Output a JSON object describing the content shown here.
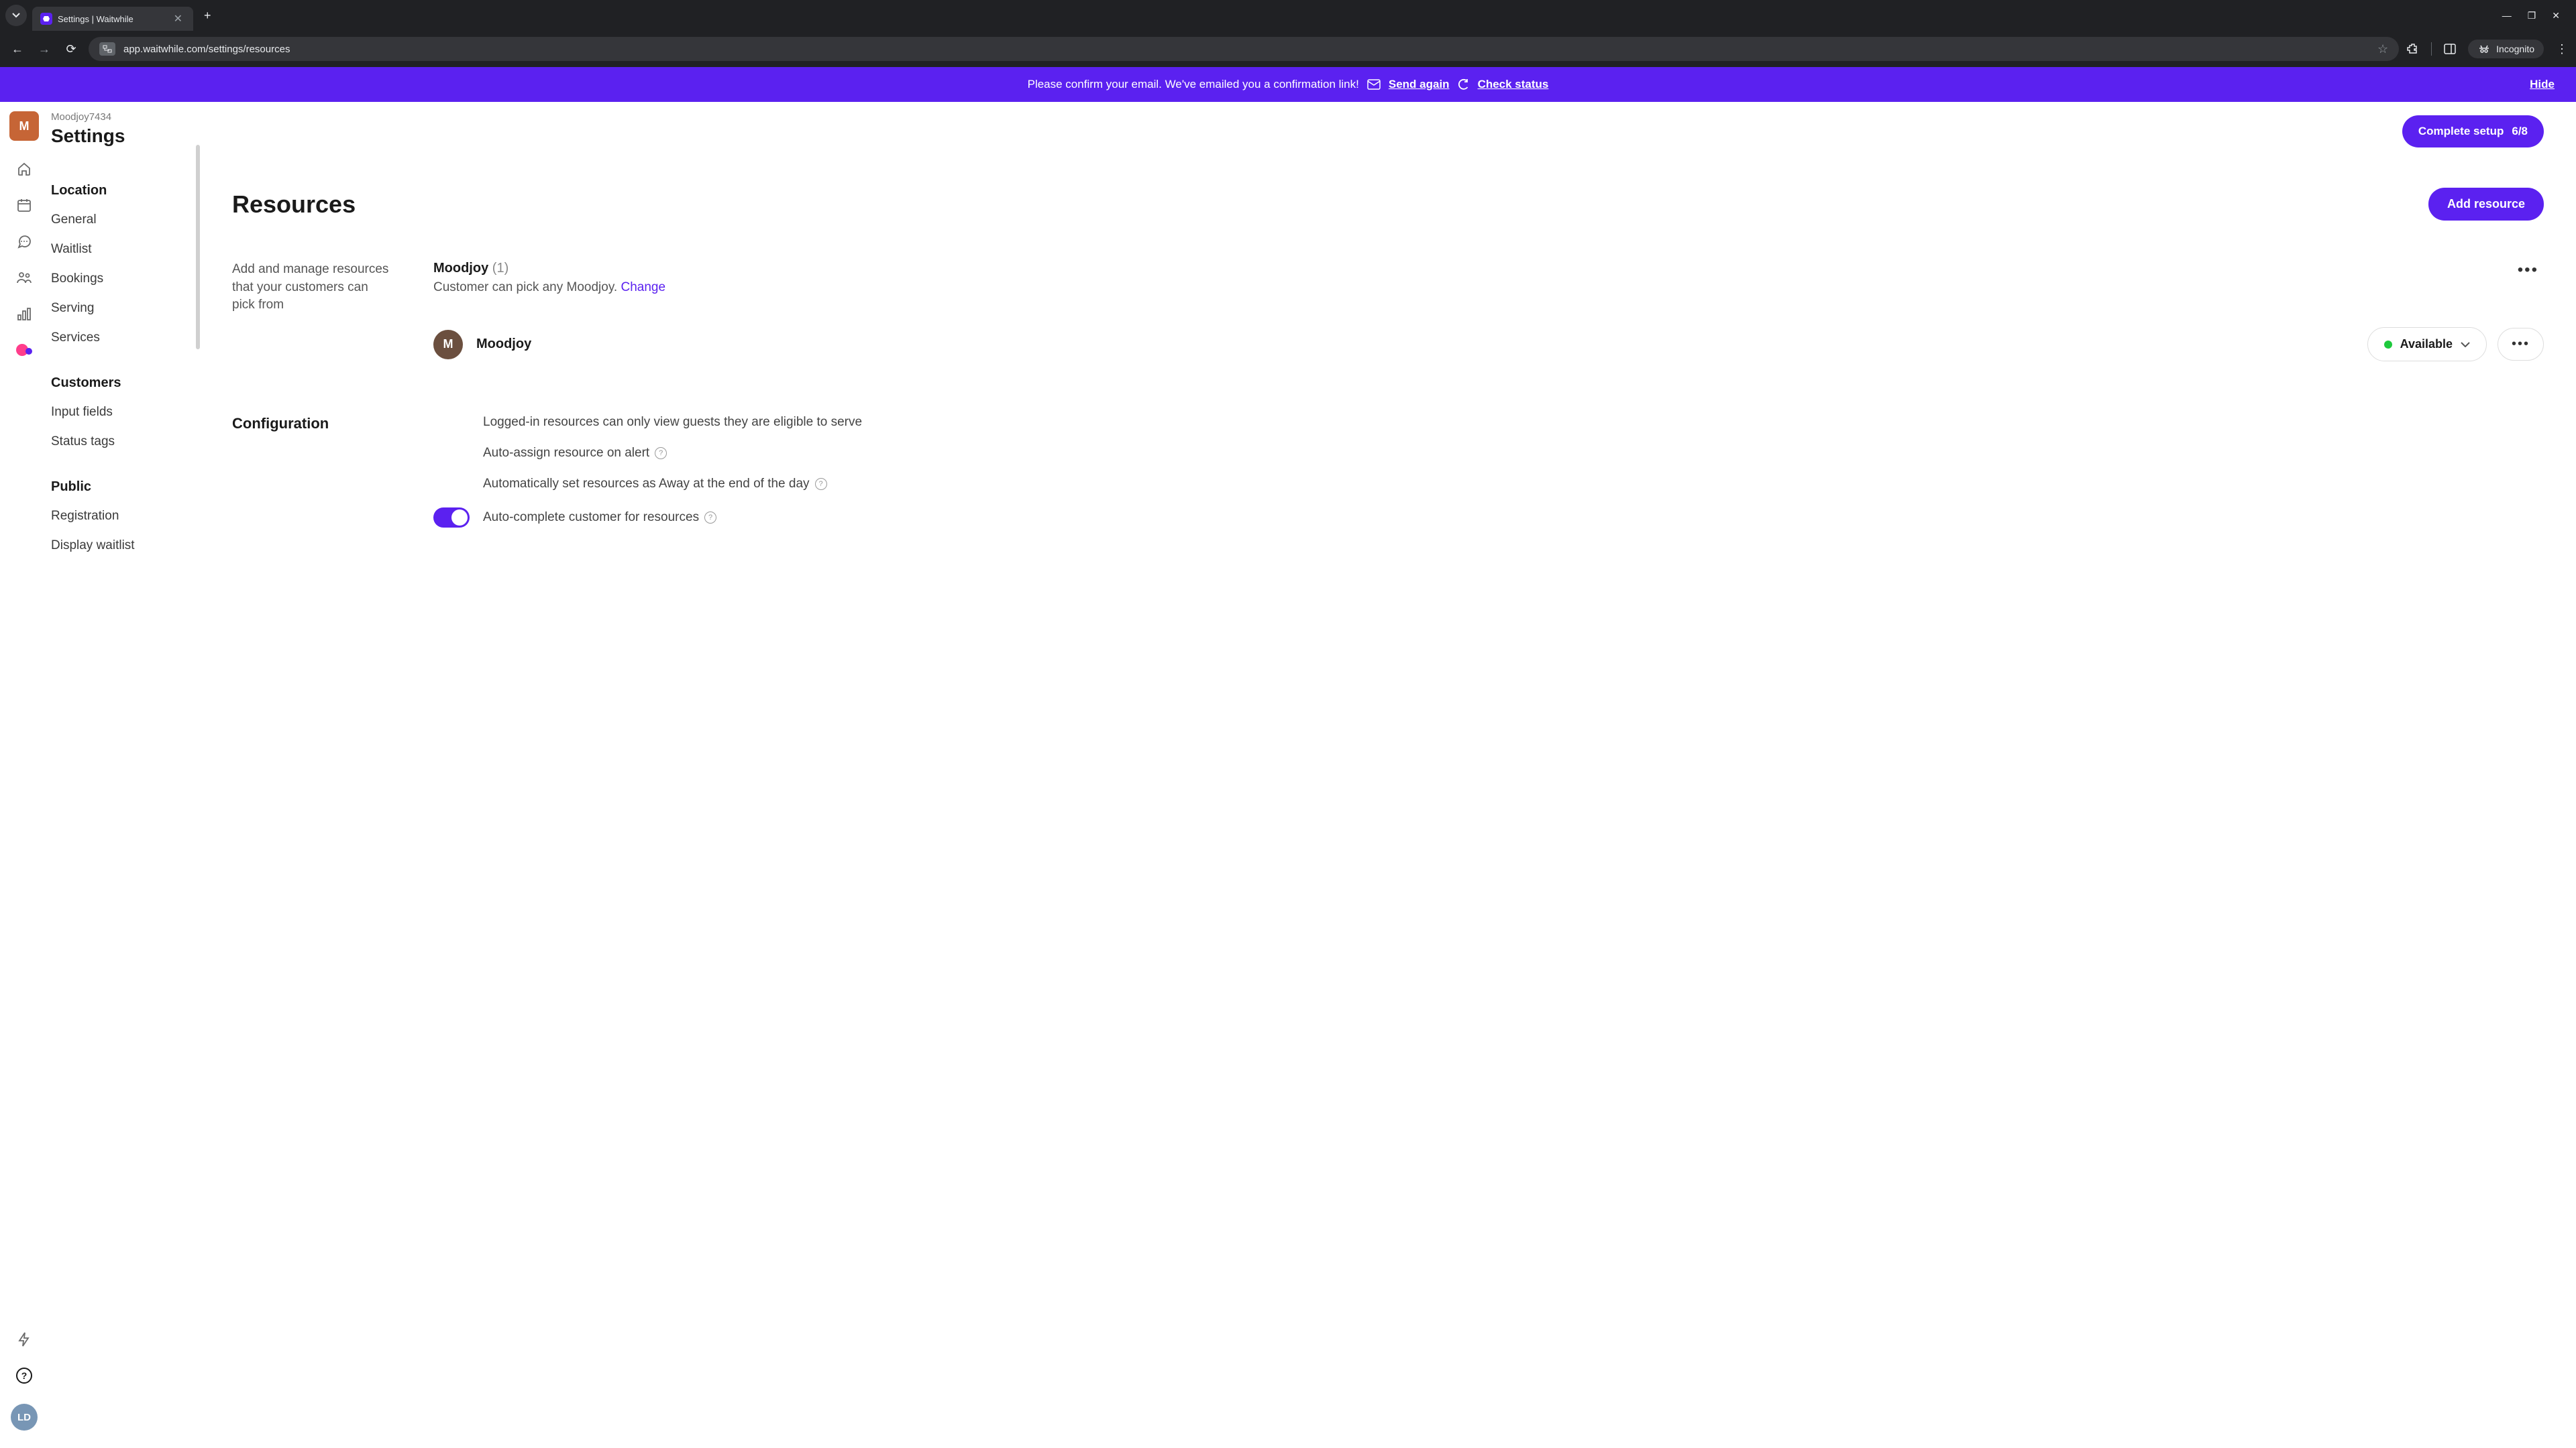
{
  "browser": {
    "tab_title": "Settings | Waitwhile",
    "url": "app.waitwhile.com/settings/resources",
    "incognito_label": "Incognito"
  },
  "banner": {
    "message": "Please confirm your email. We've emailed you a confirmation link!",
    "send_again": "Send again",
    "check_status": "Check status",
    "hide": "Hide"
  },
  "rail": {
    "org_initial": "M",
    "user_initials": "LD"
  },
  "sidebar": {
    "org_name": "Moodjoy7434",
    "page_title": "Settings",
    "sections": [
      {
        "heading": "Location",
        "items": [
          "General",
          "Waitlist",
          "Bookings",
          "Serving",
          "Services"
        ]
      },
      {
        "heading": "Customers",
        "items": [
          "Input fields",
          "Status tags"
        ]
      },
      {
        "heading": "Public",
        "items": [
          "Registration",
          "Display waitlist"
        ]
      }
    ]
  },
  "header": {
    "setup_label": "Complete setup",
    "setup_progress": "6/8"
  },
  "main": {
    "title": "Resources",
    "add_button": "Add resource",
    "description": "Add and manage resources that your customers can pick from",
    "group": {
      "name": "Moodjoy",
      "count": "(1)",
      "subtitle": "Customer can pick any Moodjoy.",
      "change": "Change"
    },
    "resource": {
      "initial": "M",
      "name": "Moodjoy",
      "status": "Available"
    },
    "config": {
      "title": "Configuration",
      "options": [
        {
          "label": "Logged-in resources can only view guests they are eligible to serve",
          "help": false,
          "toggle": null
        },
        {
          "label": "Auto-assign resource on alert",
          "help": true,
          "toggle": null
        },
        {
          "label": "Automatically set resources as Away at the end of the day",
          "help": true,
          "toggle": null
        },
        {
          "label": "Auto-complete customer for resources",
          "help": true,
          "toggle": true
        }
      ]
    }
  }
}
